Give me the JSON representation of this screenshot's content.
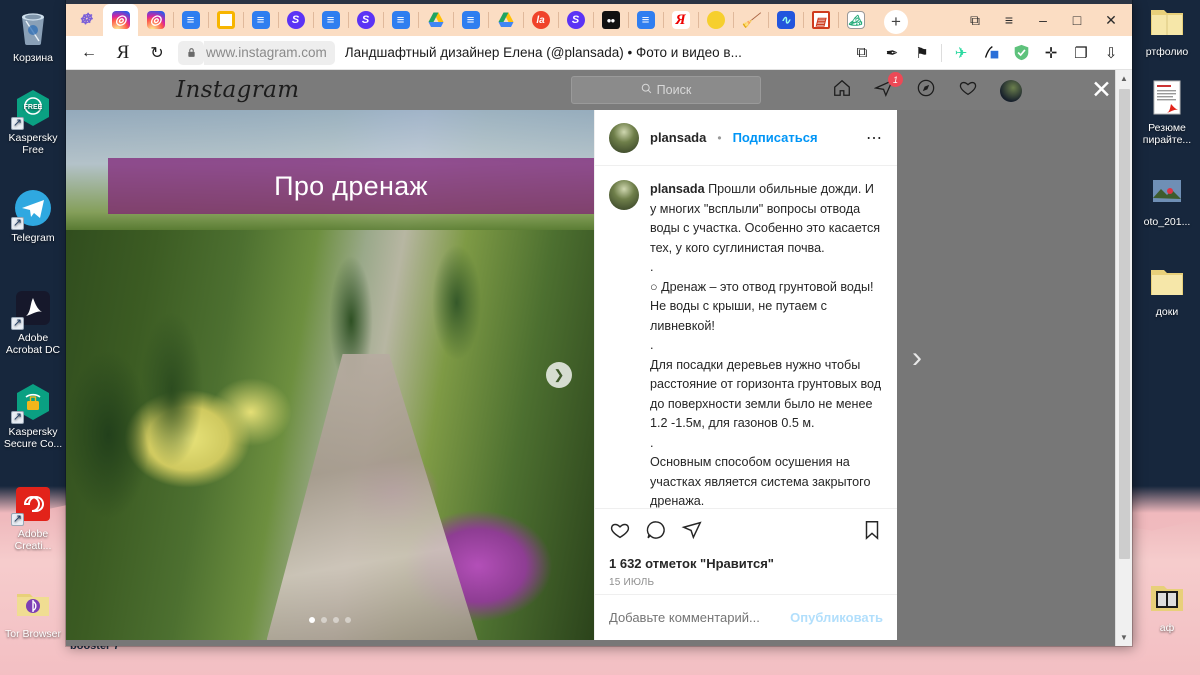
{
  "desktop": {
    "left_icons": [
      {
        "label": "Корзина",
        "icon": "recycle-bin-icon"
      },
      {
        "label": "Kaspersky Free",
        "icon": "kaspersky-free-icon"
      },
      {
        "label": "Telegram",
        "icon": "telegram-icon"
      },
      {
        "label": "Adobe Acrobat DC",
        "icon": "adobe-acrobat-icon"
      },
      {
        "label": "Kaspersky Secure Co...",
        "icon": "kaspersky-secure-connection-icon"
      },
      {
        "label": "Adobe Creati...",
        "icon": "adobe-creative-cloud-icon"
      },
      {
        "label": "Tor Browser",
        "icon": "tor-browser-icon"
      }
    ],
    "right_icons": [
      {
        "label": "ртфолио",
        "icon": "folder-icon"
      },
      {
        "label": "Резюме пирайте...",
        "icon": "pdf-document-icon"
      },
      {
        "label": "oto_201...",
        "icon": "photo-file-icon"
      },
      {
        "label": "доки",
        "icon": "folder-icon"
      },
      {
        "label": "аф",
        "icon": "folder-icon"
      }
    ],
    "taskbar_residue": "booster 7"
  },
  "browser": {
    "tabs": [
      {
        "name": "cluster",
        "icon": "cluster-icon",
        "active": false
      },
      {
        "name": "instagram-active",
        "icon": "instagram-icon",
        "active": true
      },
      {
        "name": "instagram-2",
        "icon": "instagram-icon",
        "active": false
      },
      {
        "name": "doc-1",
        "icon": "document-icon",
        "active": false
      },
      {
        "name": "yellow-box",
        "icon": "yellow-box-icon",
        "active": false
      },
      {
        "name": "doc-2",
        "icon": "document-icon",
        "active": false
      },
      {
        "name": "skype-1",
        "icon": "skype-icon",
        "active": false
      },
      {
        "name": "doc-3",
        "icon": "document-icon",
        "active": false
      },
      {
        "name": "skype-2",
        "icon": "skype-icon",
        "active": false
      },
      {
        "name": "doc-4",
        "icon": "document-icon",
        "active": false
      },
      {
        "name": "drive-1",
        "icon": "google-drive-icon",
        "active": false
      },
      {
        "name": "doc-5",
        "icon": "document-icon",
        "active": false
      },
      {
        "name": "drive-2",
        "icon": "google-drive-icon",
        "active": false
      },
      {
        "name": "la",
        "icon": "la-icon",
        "active": false
      },
      {
        "name": "skype-3",
        "icon": "skype-icon",
        "active": false
      },
      {
        "name": "medium",
        "icon": "medium-icon",
        "active": false
      },
      {
        "name": "doc-6",
        "icon": "document-icon",
        "active": false
      },
      {
        "name": "yandex",
        "icon": "yandex-icon",
        "active": false
      },
      {
        "name": "sun",
        "icon": "sun-icon",
        "active": false
      },
      {
        "name": "broom",
        "icon": "broom-icon",
        "active": false
      },
      {
        "name": "chart",
        "icon": "chart-icon",
        "active": false
      },
      {
        "name": "book",
        "icon": "book-icon",
        "active": false
      },
      {
        "name": "photo",
        "icon": "photo-icon",
        "active": false
      }
    ],
    "new_tab_label": "+",
    "window_controls": {
      "restore": "⧉",
      "menu": "≡",
      "minimize": "–",
      "maximize": "□",
      "close": "✕"
    },
    "toolbar": {
      "back": "←",
      "yandex_home": "Я",
      "reload": "↻",
      "lock": "🔒",
      "url_host": "www.instagram.com",
      "page_title": "Ландшафтный дизайнер Елена (@plansada) • Фото и видео в...",
      "extensions": [
        {
          "name": "copy-page-icon",
          "glyph": "⧉"
        },
        {
          "name": "reader-mode-icon",
          "glyph": "✒"
        },
        {
          "name": "bookmark-icon",
          "glyph": "⚑"
        },
        {
          "name": "translate-icon",
          "glyph": "✈"
        },
        {
          "name": "pen-extension-icon",
          "glyph": "✎"
        },
        {
          "name": "adblock-shield-icon",
          "glyph": "✓"
        },
        {
          "name": "ruler-icon",
          "glyph": "✛"
        },
        {
          "name": "tab-manager-icon",
          "glyph": "❐"
        },
        {
          "name": "download-icon",
          "glyph": "⇩"
        }
      ]
    }
  },
  "instagram": {
    "logo": "Instagram",
    "search_placeholder": "Поиск",
    "search_icon": "search-icon",
    "nav": [
      {
        "name": "home-icon",
        "glyph": "⌂"
      },
      {
        "name": "direct-messages-icon",
        "glyph": "➤",
        "badge": "1"
      },
      {
        "name": "explore-compass-icon",
        "glyph": "⦿"
      },
      {
        "name": "activity-heart-icon",
        "glyph": "♡"
      },
      {
        "name": "profile-avatar",
        "glyph": ""
      }
    ],
    "close_label": "✕",
    "post": {
      "username": "plansada",
      "separator": "•",
      "follow_label": "Подписаться",
      "more_options": "⋯",
      "banner_text": "Про дренаж",
      "caption_author": "plansada",
      "caption_body": " Прошли обильные дожди. И у многих \"всплыли\" вопросы отвода воды с участка. Особенно это касается тех, у кого суглинистая почва.\n.\n○ Дренаж – это отвод грунтовой воды! Не воды с крыши, не путаем с ливневкой!\n.\nДля посадки деревьев нужно чтобы расстояние от горизонта грунтовых вод до поверхности земли было не менее 1.2 -1.5м, для газонов 0.5 м.\n.\nОсновным способом осушения на участках является система закрытого дренажа.\n.\n▤ Вначале составляем схему",
      "actions": [
        {
          "name": "like-heart-icon",
          "glyph": "♡"
        },
        {
          "name": "comment-bubble-icon",
          "glyph": "◯"
        },
        {
          "name": "share-paper-plane-icon",
          "glyph": "▷"
        },
        {
          "name": "save-bookmark-icon",
          "glyph": "☐"
        }
      ],
      "likes": "1 632 отметок \"Нравится\"",
      "date": "15 ИЮЛЬ",
      "comment_placeholder": "Добавьте комментарий...",
      "post_button": "Опубликовать",
      "carousel": {
        "total": 4,
        "active_index": 0
      },
      "prev_arrow": "‹",
      "next_arrow": "›",
      "next_circle_arrow": "❯"
    }
  },
  "colors": {
    "instagram_blue": "#0095f6",
    "badge_red": "#ed4956",
    "banner_purple": "#7e1d75",
    "tabstrip_peach": "#fbddc3",
    "desktop_navy": "#17273d"
  }
}
